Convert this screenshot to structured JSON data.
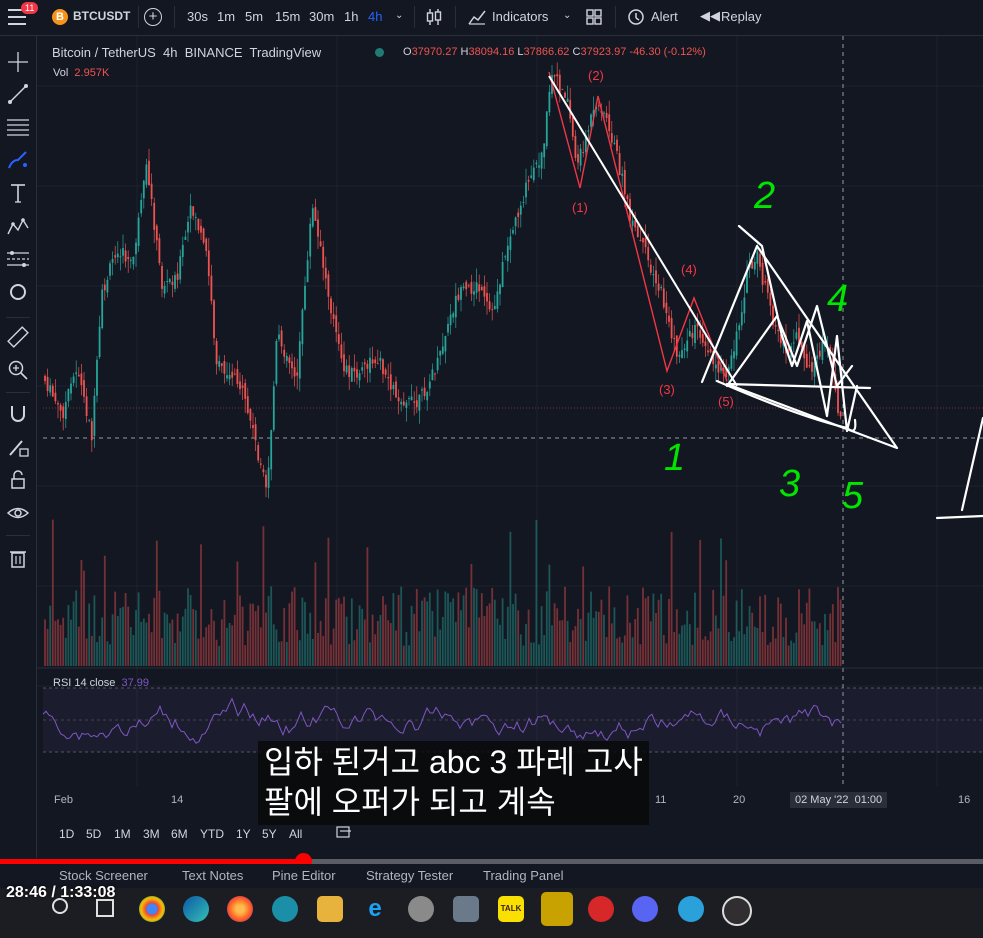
{
  "topbar": {
    "notification_count": "11",
    "symbol": "BTCUSDT",
    "intervals": [
      "30s",
      "1m",
      "5m",
      "15m",
      "30m",
      "1h",
      "4h"
    ],
    "active_interval": "4h",
    "indicators_label": "Indicators",
    "alert_label": "Alert",
    "replay_label": "Replay"
  },
  "chart": {
    "title": "Bitcoin / TetherUS",
    "interval": "4h",
    "exchange": "BINANCE",
    "source": "TradingView",
    "ohlc": {
      "o_label": "O",
      "o": "37970.27",
      "h_label": "H",
      "h": "38094.16",
      "l_label": "L",
      "l": "37866.62",
      "c_label": "C",
      "c": "37923.97",
      "change": "-46.30 (-0.12%)"
    },
    "volume_label": "Vol",
    "volume_value": "2.957K",
    "rsi_label": "RSI 14 close",
    "rsi_value": "37.99",
    "wave_labels": [
      "(1)",
      "(2)",
      "(3)",
      "(4)",
      "(5)"
    ],
    "handwritten_numbers": [
      "1",
      "2",
      "3",
      "4",
      "5"
    ],
    "x_axis": [
      "Feb",
      "14",
      "11",
      "20",
      "16"
    ],
    "x_axis_highlight": "02 May '22",
    "x_axis_time": "01:00"
  },
  "timeframes": [
    "1D",
    "5D",
    "1M",
    "3M",
    "6M",
    "YTD",
    "1Y",
    "5Y",
    "All"
  ],
  "subtitle": {
    "line1": "입하 된거고 abc 3 파레 고사",
    "line2": "팔에 오퍼가 되고 계속"
  },
  "player": {
    "time": "28:46 / 1:33:08",
    "progress": 0.308
  },
  "bottom_tabs": [
    "Stock Screener",
    "Text Notes",
    "Pine Editor",
    "Strategy Tester",
    "Trading Panel"
  ],
  "colors": {
    "background": "#131722",
    "up": "#26a69a",
    "down": "#ef5350",
    "rsi": "#7e57c2",
    "accent": "#2962ff",
    "wave": "#f23645",
    "drawing": "#ffffff",
    "handwriting": "#00e600"
  }
}
